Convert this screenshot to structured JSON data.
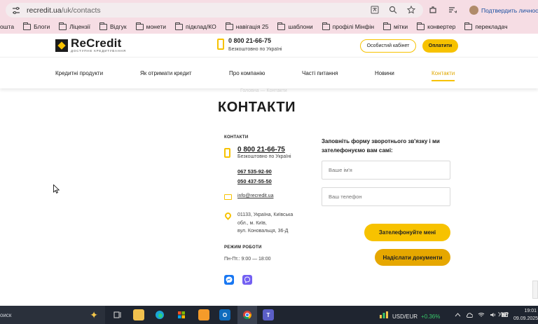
{
  "browser": {
    "url_host": "recredit.ua",
    "url_path": "/uk/contacts",
    "profile_label": "Подтвердить личность"
  },
  "bookmarks": [
    "ошта",
    "Блоги",
    "Ліцензії",
    "Відгук",
    "монети",
    "підклад/КО",
    "навігація 25",
    "шаблони",
    "профілі Мінфін",
    "мітки",
    "конвертер",
    "перекладач"
  ],
  "header": {
    "logo_name": "ReCredit",
    "logo_tagline": "ДОСТУПНЕ КРЕДИТУВАННЯ",
    "phone": "0 800 21-66-75",
    "phone_note": "Безкоштовно по Україні",
    "cabinet_button": "Особистий кабінет",
    "pay_button": "Оплатити"
  },
  "nav": {
    "items": [
      "Кредитні продукти",
      "Як отримати кредит",
      "Про компанію",
      "Часті питання",
      "Новини",
      "Контакти"
    ]
  },
  "breadcrumb": "Головна — Контакти",
  "page_title": "КОНТАКТИ",
  "contacts": {
    "heading": "КОНТАКТИ",
    "main_phone": "0 800 21-66-75",
    "main_phone_note": "Безкоштовно по Україні",
    "phone_2": "067 535-92-90",
    "phone_3": "050 437-55-50",
    "email": "info@recredit.ua",
    "address_line1": "01133, Україна, Київська",
    "address_line2": "обл., м. Київ,",
    "address_line3": "вул. Коновальця, 36-Д",
    "hours_heading": "РЕЖИМ РОБОТИ",
    "hours": "Пн-Пт.: 9:00 — 18:00"
  },
  "form": {
    "title": "Заповніть форму зворотнього зв'язку і ми зателефонуємо вам самі:",
    "name_placeholder": "Ваше ім'я",
    "phone_placeholder": "Ваш телефон",
    "call_button": "Зателефонуйте мені",
    "docs_button": "Надіслати документи"
  },
  "taskbar": {
    "search_label": "оиск",
    "fx_pair": "USD/EUR",
    "fx_change": "+0.36%",
    "lang": "УКР",
    "time": "19:01",
    "date": "09.09.2025"
  },
  "colors": {
    "brand_yellow": "#f7c200",
    "browser_chrome": "#f6dde4",
    "taskbar": "#1f2530"
  }
}
